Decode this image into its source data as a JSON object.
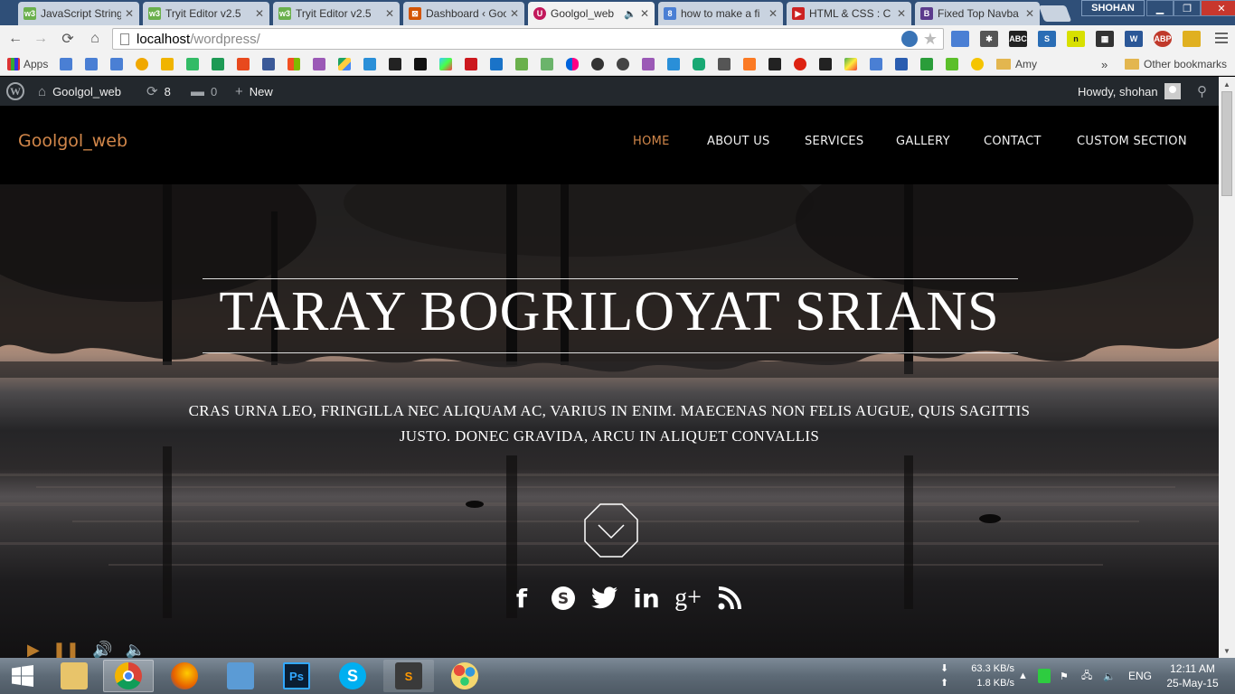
{
  "browser": {
    "tabs": [
      {
        "title": "JavaScript String",
        "color": "#6ab04c",
        "label": "w3",
        "active": false
      },
      {
        "title": "Tryit Editor v2.5",
        "color": "#6ab04c",
        "label": "w3",
        "active": false
      },
      {
        "title": "Tryit Editor v2.5",
        "color": "#6ab04c",
        "label": "w3",
        "active": false
      },
      {
        "title": "Dashboard ‹ Goo",
        "color": "#d35400",
        "label": "⊠",
        "active": false
      },
      {
        "title": "Goolgol_web",
        "color": "#c2185b",
        "label": "U",
        "active": true
      },
      {
        "title": "how to make a fi",
        "color": "#4a7fd4",
        "label": "8",
        "active": false
      },
      {
        "title": "HTML & CSS : C",
        "color": "#cc2222",
        "label": "▶",
        "active": false
      },
      {
        "title": "Fixed Top Navba",
        "color": "#5b3b8c",
        "label": "B",
        "active": false
      }
    ],
    "window_user": "SHOHAN",
    "url_host": "localhost",
    "url_path": "/wordpress/",
    "bookmarks_apps": "Apps",
    "bookmark_amy": "Amy",
    "bookmark_other": "Other bookmarks",
    "bookmark_chevron": "»"
  },
  "adminbar": {
    "site_name": "Goolgol_web",
    "updates_count": "8",
    "comments_count": "0",
    "new_label": "New",
    "howdy": "Howdy, shohan"
  },
  "site": {
    "brand": "Goolgol_web",
    "menu": [
      "HOME",
      "ABOUT US",
      "SERVICES",
      "GALLERY",
      "CONTACT",
      "CUSTOM SECTION"
    ],
    "active_menu": "HOME",
    "accent": "#d2874a"
  },
  "hero": {
    "title": "TARAY BOGRILOYAT SRIANS",
    "subtitle_line1": "CRAS URNA LEO, FRINGILLA NEC ALIQUAM AC, VARIUS IN ENIM. MAECENAS NON FELIS AUGUE, QUIS SAGITTIS",
    "subtitle_line2": "JUSTO. DONEC GRAVIDA, ARCU IN ALIQUET CONVALLIS",
    "social_icons": [
      "facebook-icon",
      "skype-icon",
      "twitter-icon",
      "linkedin-icon",
      "google-plus-icon",
      "rss-icon"
    ],
    "social_glyphs": [
      "f",
      "S",
      "🐦",
      "in",
      "g+",
      ")))"
    ]
  },
  "taskbar": {
    "net_down": "63.3 KB/s",
    "net_up": "1.8 KB/s",
    "lang": "ENG",
    "time": "12:11 AM",
    "date": "25-May-15"
  }
}
